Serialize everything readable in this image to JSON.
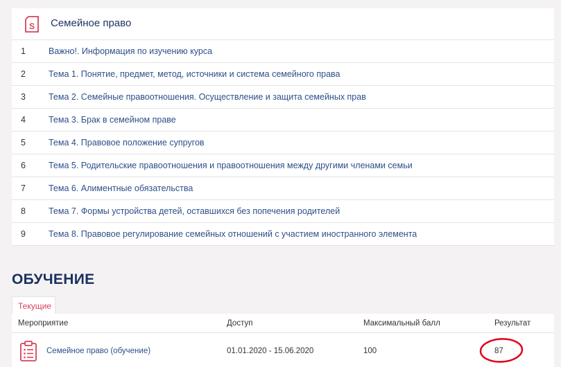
{
  "course": {
    "title": "Семейное право",
    "icon": "course-book-icon",
    "topics": [
      {
        "num": "1",
        "label": "Важно!. Информация по изучению курса"
      },
      {
        "num": "2",
        "label": "Тема 1. Понятие, предмет, метод, источники и система семейного права"
      },
      {
        "num": "3",
        "label": "Тема 2. Семейные правоотношения. Осуществление и защита семейных прав"
      },
      {
        "num": "4",
        "label": "Тема 3. Брак в семейном праве"
      },
      {
        "num": "5",
        "label": "Тема 4. Правовое положение супругов"
      },
      {
        "num": "6",
        "label": "Тема 5. Родительские правоотношения и правоотношения между другими членами семьи"
      },
      {
        "num": "7",
        "label": "Тема 6. Алиментные обязательства"
      },
      {
        "num": "8",
        "label": "Тема 7. Формы устройства детей, оставшихся без попечения родителей"
      },
      {
        "num": "9",
        "label": "Тема 8. Правовое регулирование семейных отношений с участием иностранного элемента"
      }
    ]
  },
  "learning": {
    "section_title": "ОБУЧЕНИЕ",
    "tab_current": "Текущие",
    "table": {
      "headers": {
        "activity": "Мероприятие",
        "access": "Доступ",
        "max_score": "Максимальный балл",
        "result": "Результат"
      },
      "row": {
        "activity": "Семейное право (обучение)",
        "access": "01.01.2020 - 15.06.2020",
        "max_score": "100",
        "result": "87",
        "icon": "clipboard-list-icon"
      }
    }
  },
  "colors": {
    "accent": "#d9405a",
    "link": "#2d4f8a",
    "heading": "#1a3260",
    "annotation": "#e0001a"
  }
}
